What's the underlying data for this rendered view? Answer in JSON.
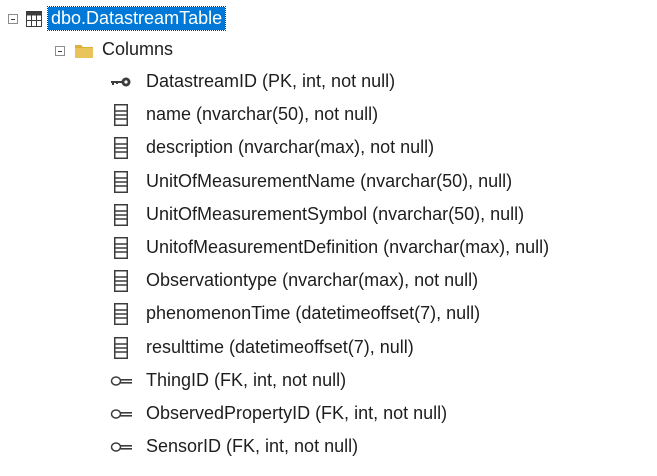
{
  "tree": {
    "table": {
      "label": "dbo.DatastreamTable"
    },
    "folder": {
      "label": "Columns"
    },
    "columns": [
      {
        "label": "DatastreamID (PK, int, not null)",
        "icon": "primary-key-icon"
      },
      {
        "label": "name (nvarchar(50), not null)",
        "icon": "column-icon"
      },
      {
        "label": "description (nvarchar(max), not null)",
        "icon": "column-icon"
      },
      {
        "label": "UnitOfMeasurementName (nvarchar(50), null)",
        "icon": "column-icon"
      },
      {
        "label": "UnitOfMeasurementSymbol (nvarchar(50), null)",
        "icon": "column-icon"
      },
      {
        "label": "UnitofMeasurementDefinition (nvarchar(max), null)",
        "icon": "column-icon"
      },
      {
        "label": "Observationtype (nvarchar(max), not null)",
        "icon": "column-icon"
      },
      {
        "label": "phenomenonTime (datetimeoffset(7), null)",
        "icon": "column-icon"
      },
      {
        "label": "resulttime (datetimeoffset(7), null)",
        "icon": "column-icon"
      },
      {
        "label": "ThingID (FK, int, not null)",
        "icon": "foreign-key-icon"
      },
      {
        "label": "ObservedPropertyID (FK, int, not null)",
        "icon": "foreign-key-icon"
      },
      {
        "label": "SensorID (FK, int, not null)",
        "icon": "foreign-key-icon"
      }
    ]
  },
  "colors": {
    "selection": "#0078d7",
    "folder": "#dcb13c",
    "icon": "#3c3c3c"
  }
}
